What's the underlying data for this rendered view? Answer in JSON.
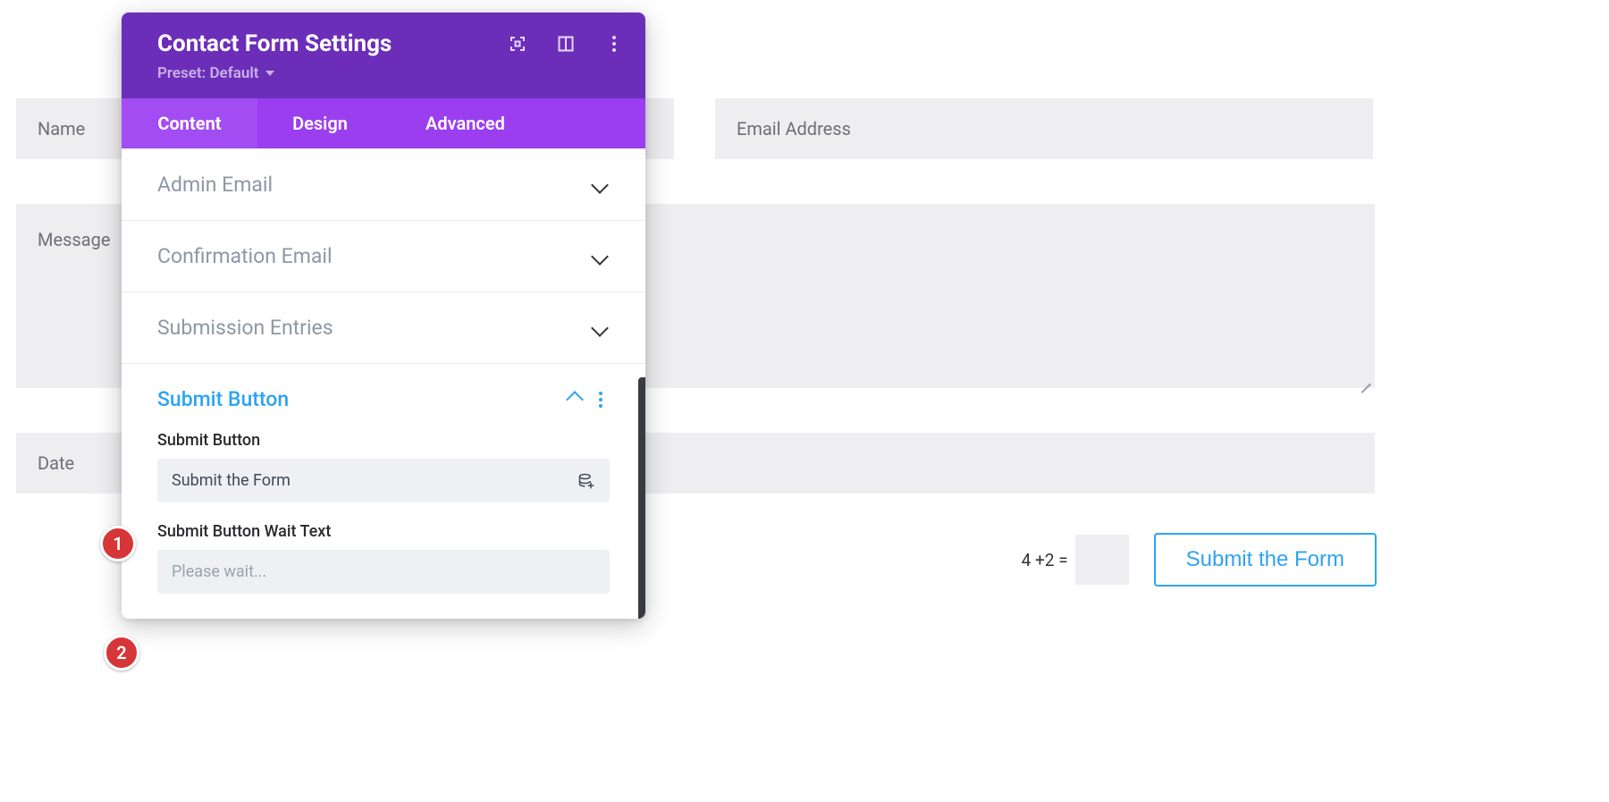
{
  "page_fields": {
    "name_placeholder": "Name",
    "email_placeholder": "Email Address",
    "message_placeholder": "Message",
    "date_placeholder": "Date"
  },
  "captcha": {
    "equation_text": "4 +2 ="
  },
  "submit": {
    "button_text": "Submit the Form"
  },
  "panel": {
    "title": "Contact Form Settings",
    "preset_label": "Preset: Default",
    "tabs": {
      "content": "Content",
      "design": "Design",
      "advanced": "Advanced"
    },
    "sections": {
      "admin_email": "Admin Email",
      "confirmation_email": "Confirmation Email",
      "submission_entries": "Submission Entries",
      "submit_button": "Submit Button"
    },
    "submit_section": {
      "submit_button_label": "Submit Button",
      "submit_button_value": "Submit the Form",
      "wait_text_label": "Submit Button Wait Text",
      "wait_text_placeholder": "Please wait..."
    }
  },
  "markers": {
    "one": "1",
    "two": "2"
  },
  "colors": {
    "brand_purple_dark": "#6c2eb9",
    "brand_purple": "#9a3ef0",
    "accent_blue": "#2ea3f2",
    "marker_red": "#d63638"
  }
}
